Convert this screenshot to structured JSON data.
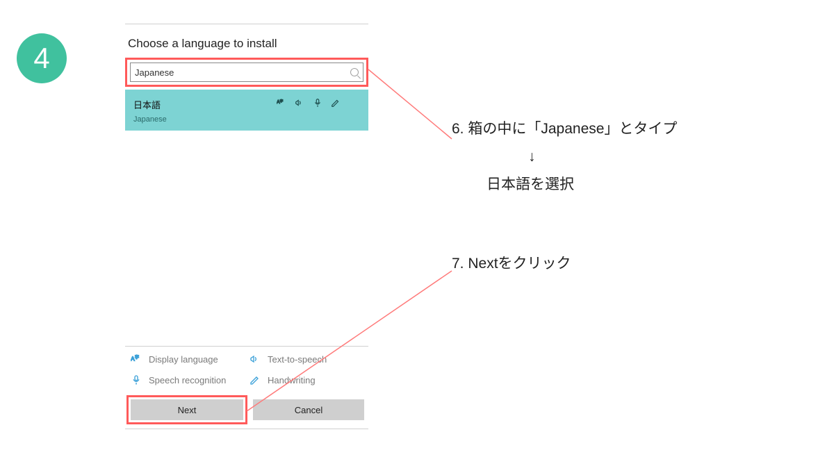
{
  "step_number": "4",
  "dialog": {
    "title": "Choose a language to install",
    "search_value": "Japanese",
    "result": {
      "native": "日本語",
      "english": "Japanese"
    },
    "legend": {
      "display_language": "Display language",
      "text_to_speech": "Text-to-speech",
      "speech_recognition": "Speech recognition",
      "handwriting": "Handwriting"
    },
    "buttons": {
      "next": "Next",
      "cancel": "Cancel"
    }
  },
  "annotations": {
    "step6_line1": "6. 箱の中に「Japanese」とタイプ",
    "step6_arrow": "↓",
    "step6_line2": "日本語を選択",
    "step7": "7.  Nextをクリック"
  },
  "colors": {
    "badge": "#40c19e",
    "highlight": "#ff5a5a",
    "result_bg": "#7dd3d3",
    "line": "#ff7a7a"
  }
}
